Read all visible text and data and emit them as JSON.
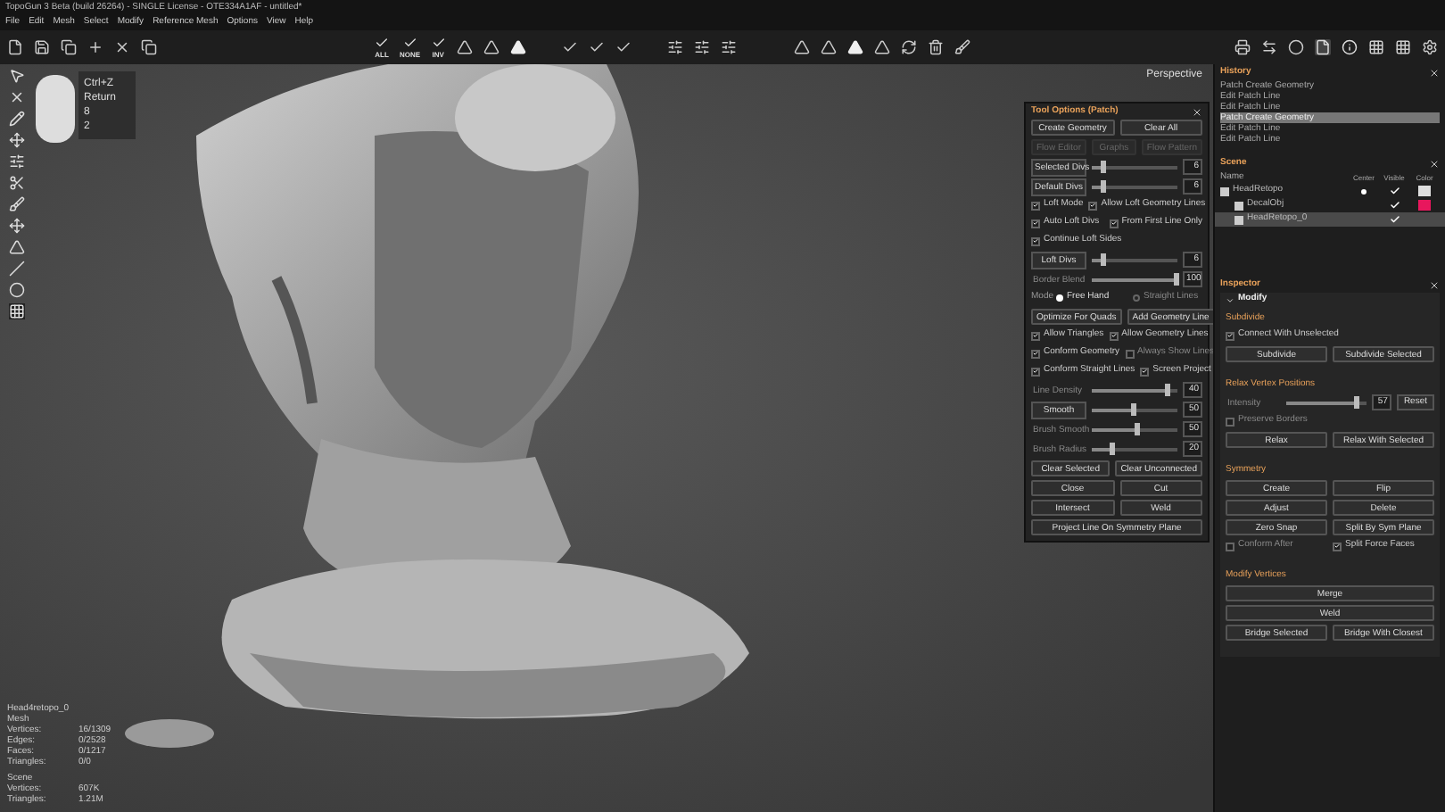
{
  "window": {
    "title": "TopoGun 3 Beta (build 26264) - SINGLE License - OTE334A1AF - untitled*"
  },
  "menu": [
    "File",
    "Edit",
    "Mesh",
    "Select",
    "Modify",
    "Reference Mesh",
    "Options",
    "View",
    "Help"
  ],
  "toolbar": {
    "select_labels": [
      "ALL",
      "NONE",
      "INV"
    ]
  },
  "viewport": {
    "label": "Perspective",
    "hotkeys": [
      "Ctrl+Z",
      "Return",
      "8",
      "2"
    ],
    "stats": {
      "object": "Head4retopo_0",
      "mesh_label": "Mesh",
      "mesh_rows": [
        {
          "label": "Vertices:",
          "value": "16/1309"
        },
        {
          "label": "Edges:",
          "value": "0/2528"
        },
        {
          "label": "Faces:",
          "value": "0/1217"
        },
        {
          "label": "Triangles:",
          "value": "0/0"
        }
      ],
      "scene_label": "Scene",
      "scene_rows": [
        {
          "label": "Vertices:",
          "value": "607K"
        },
        {
          "label": "Triangles:",
          "value": "1.21M"
        }
      ]
    }
  },
  "tool_options": {
    "title": "Tool Options (Patch)",
    "rows": [
      {
        "kind": "buttons",
        "buttons": [
          {
            "label": "Create Geometry",
            "disabled": false
          },
          {
            "label": "Clear All",
            "disabled": false
          }
        ]
      },
      {
        "kind": "buttons",
        "buttons": [
          {
            "label": "Flow Editor",
            "disabled": true
          },
          {
            "label": "Graphs",
            "disabled": true
          },
          {
            "label": "Flow Pattern",
            "disabled": true
          }
        ]
      },
      {
        "kind": "slider",
        "label": "Selected Divs",
        "boxed": true,
        "disabled": false,
        "level": 0.15,
        "value": "6"
      },
      {
        "kind": "slider",
        "label": "Default Divs",
        "boxed": true,
        "disabled": false,
        "level": 0.15,
        "value": "6"
      },
      {
        "kind": "checks",
        "items": [
          {
            "label": "Loft Mode",
            "checked": true
          },
          {
            "label": "Allow Loft Geometry Lines",
            "checked": true
          }
        ]
      },
      {
        "kind": "checks",
        "items": [
          {
            "label": "Auto Loft Divs",
            "checked": true
          },
          {
            "label": "From First Line Only",
            "checked": true
          }
        ]
      },
      {
        "kind": "checks",
        "items": [
          {
            "label": "Continue Loft Sides",
            "checked": true
          }
        ]
      },
      {
        "kind": "slider",
        "label": "Loft Divs",
        "boxed": true,
        "disabled": false,
        "level": 0.15,
        "value": "6"
      },
      {
        "kind": "slider",
        "label": "Border Blend",
        "boxed": false,
        "disabled": true,
        "level": 1,
        "value": "100"
      },
      {
        "kind": "radio",
        "label": "Mode",
        "options": [
          {
            "label": "Free Hand",
            "selected": true
          },
          {
            "label": "Straight Lines",
            "selected": false
          }
        ]
      },
      {
        "kind": "buttons",
        "buttons": [
          {
            "label": "Optimize For Quads",
            "disabled": false
          },
          {
            "label": "Add Geometry Line",
            "disabled": false
          }
        ]
      },
      {
        "kind": "checks",
        "items": [
          {
            "label": "Allow Triangles",
            "checked": true
          },
          {
            "label": "Allow Geometry Lines",
            "checked": true
          }
        ]
      },
      {
        "kind": "checks",
        "items": [
          {
            "label": "Conform Geometry",
            "checked": true
          },
          {
            "label": "Always Show Lines",
            "checked": false
          }
        ]
      },
      {
        "kind": "checks",
        "items": [
          {
            "label": "Conform Straight Lines",
            "checked": true
          },
          {
            "label": "Screen Project",
            "checked": true
          }
        ]
      },
      {
        "kind": "slider",
        "label": "Line Density",
        "boxed": false,
        "disabled": true,
        "level": 0.9,
        "value": "40"
      },
      {
        "kind": "slider",
        "label": "Smooth",
        "boxed": true,
        "disabled": false,
        "level": 0.5,
        "value": "50"
      },
      {
        "kind": "slider",
        "label": "Brush Smooth",
        "boxed": false,
        "disabled": true,
        "level": 0.55,
        "value": "50"
      },
      {
        "kind": "slider",
        "label": "Brush Radius",
        "boxed": false,
        "disabled": true,
        "level": 0.25,
        "value": "20"
      },
      {
        "kind": "buttons",
        "buttons": [
          {
            "label": "Clear Selected",
            "disabled": false
          },
          {
            "label": "Clear Unconnected",
            "disabled": false
          }
        ]
      },
      {
        "kind": "buttons",
        "buttons": [
          {
            "label": "Close",
            "disabled": false
          },
          {
            "label": "Cut",
            "disabled": false
          }
        ]
      },
      {
        "kind": "buttons",
        "buttons": [
          {
            "label": "Intersect",
            "disabled": false
          },
          {
            "label": "Weld",
            "disabled": false
          }
        ]
      },
      {
        "kind": "buttons",
        "buttons": [
          {
            "label": "Project Line On Symmetry Plane",
            "disabled": false
          }
        ]
      }
    ]
  },
  "history": {
    "title": "History",
    "items": [
      {
        "label": "Patch Create Geometry",
        "selected": false
      },
      {
        "label": "Edit Patch Line",
        "selected": false
      },
      {
        "label": "Edit Patch Line",
        "selected": false
      },
      {
        "label": "Patch Create Geometry",
        "selected": true
      },
      {
        "label": "Edit Patch Line",
        "selected": false
      },
      {
        "label": "Edit Patch Line",
        "selected": false
      }
    ]
  },
  "scene": {
    "title": "Scene",
    "columns": [
      "Name",
      "Center",
      "Visible",
      "Color"
    ],
    "objects": [
      {
        "name": "HeadRetopo",
        "center": true,
        "visible": true,
        "color": "#dedede",
        "selected": false,
        "children": [
          {
            "name": "DecalObj",
            "center": false,
            "visible": true,
            "color": "#e8175d",
            "selected": false
          },
          {
            "name": "HeadRetopo_0",
            "center": false,
            "visible": true,
            "selected": true
          }
        ]
      }
    ]
  },
  "inspector": {
    "title": "Inspector",
    "section": "Modify",
    "groups": [
      {
        "title": "Subdivide",
        "rows": [
          {
            "kind": "checks",
            "items": [
              {
                "label": "Connect With Unselected",
                "checked": true
              }
            ]
          },
          {
            "kind": "buttons",
            "buttons": [
              {
                "label": "Subdivide",
                "disabled": false
              },
              {
                "label": "Subdivide Selected",
                "disabled": false
              }
            ]
          }
        ]
      },
      {
        "title": "Relax Vertex Positions",
        "rows": [
          {
            "kind": "slider",
            "label": "Intensity",
            "boxed": false,
            "disabled": true,
            "level": 0.9,
            "value": "57",
            "button": "Reset"
          },
          {
            "kind": "checks",
            "items": [
              {
                "label": "Preserve Borders",
                "checked": false
              }
            ]
          },
          {
            "kind": "buttons",
            "buttons": [
              {
                "label": "Relax",
                "disabled": false
              },
              {
                "label": "Relax With Selected",
                "disabled": false
              }
            ]
          }
        ]
      },
      {
        "title": "Symmetry",
        "rows": [
          {
            "kind": "buttons",
            "buttons": [
              {
                "label": "Create",
                "disabled": false
              },
              {
                "label": "Flip",
                "disabled": false
              }
            ]
          },
          {
            "kind": "buttons",
            "buttons": [
              {
                "label": "Adjust",
                "disabled": false
              },
              {
                "label": "Delete",
                "disabled": false
              }
            ]
          },
          {
            "kind": "buttons",
            "buttons": [
              {
                "label": "Zero Snap",
                "disabled": false
              },
              {
                "label": "Split By Sym Plane",
                "disabled": false
              }
            ]
          },
          {
            "kind": "checks",
            "items": [
              {
                "label": "Conform After",
                "checked": false
              },
              {
                "label": "Split Force Faces",
                "checked": true
              }
            ]
          }
        ]
      },
      {
        "title": "Modify Vertices",
        "rows": [
          {
            "kind": "buttons",
            "buttons": [
              {
                "label": "Merge",
                "disabled": false
              }
            ]
          },
          {
            "kind": "buttons",
            "buttons": [
              {
                "label": "Weld",
                "disabled": false
              }
            ]
          },
          {
            "kind": "buttons",
            "buttons": [
              {
                "label": "Bridge Selected",
                "disabled": false
              },
              {
                "label": "Bridge With Closest",
                "disabled": false
              }
            ]
          }
        ]
      }
    ]
  }
}
